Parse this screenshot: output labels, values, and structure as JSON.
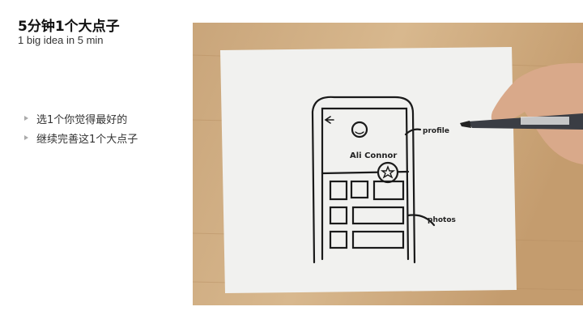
{
  "slide": {
    "title": "5分钟1个大点子",
    "subtitle": "1 big idea in 5 min",
    "bullets": [
      "选1个你觉得最好的",
      "继续完善这1个大点子"
    ]
  },
  "photo": {
    "sketch_name": "Ali Connor",
    "annotation_profile": "profile",
    "annotation_photos": "photos"
  }
}
